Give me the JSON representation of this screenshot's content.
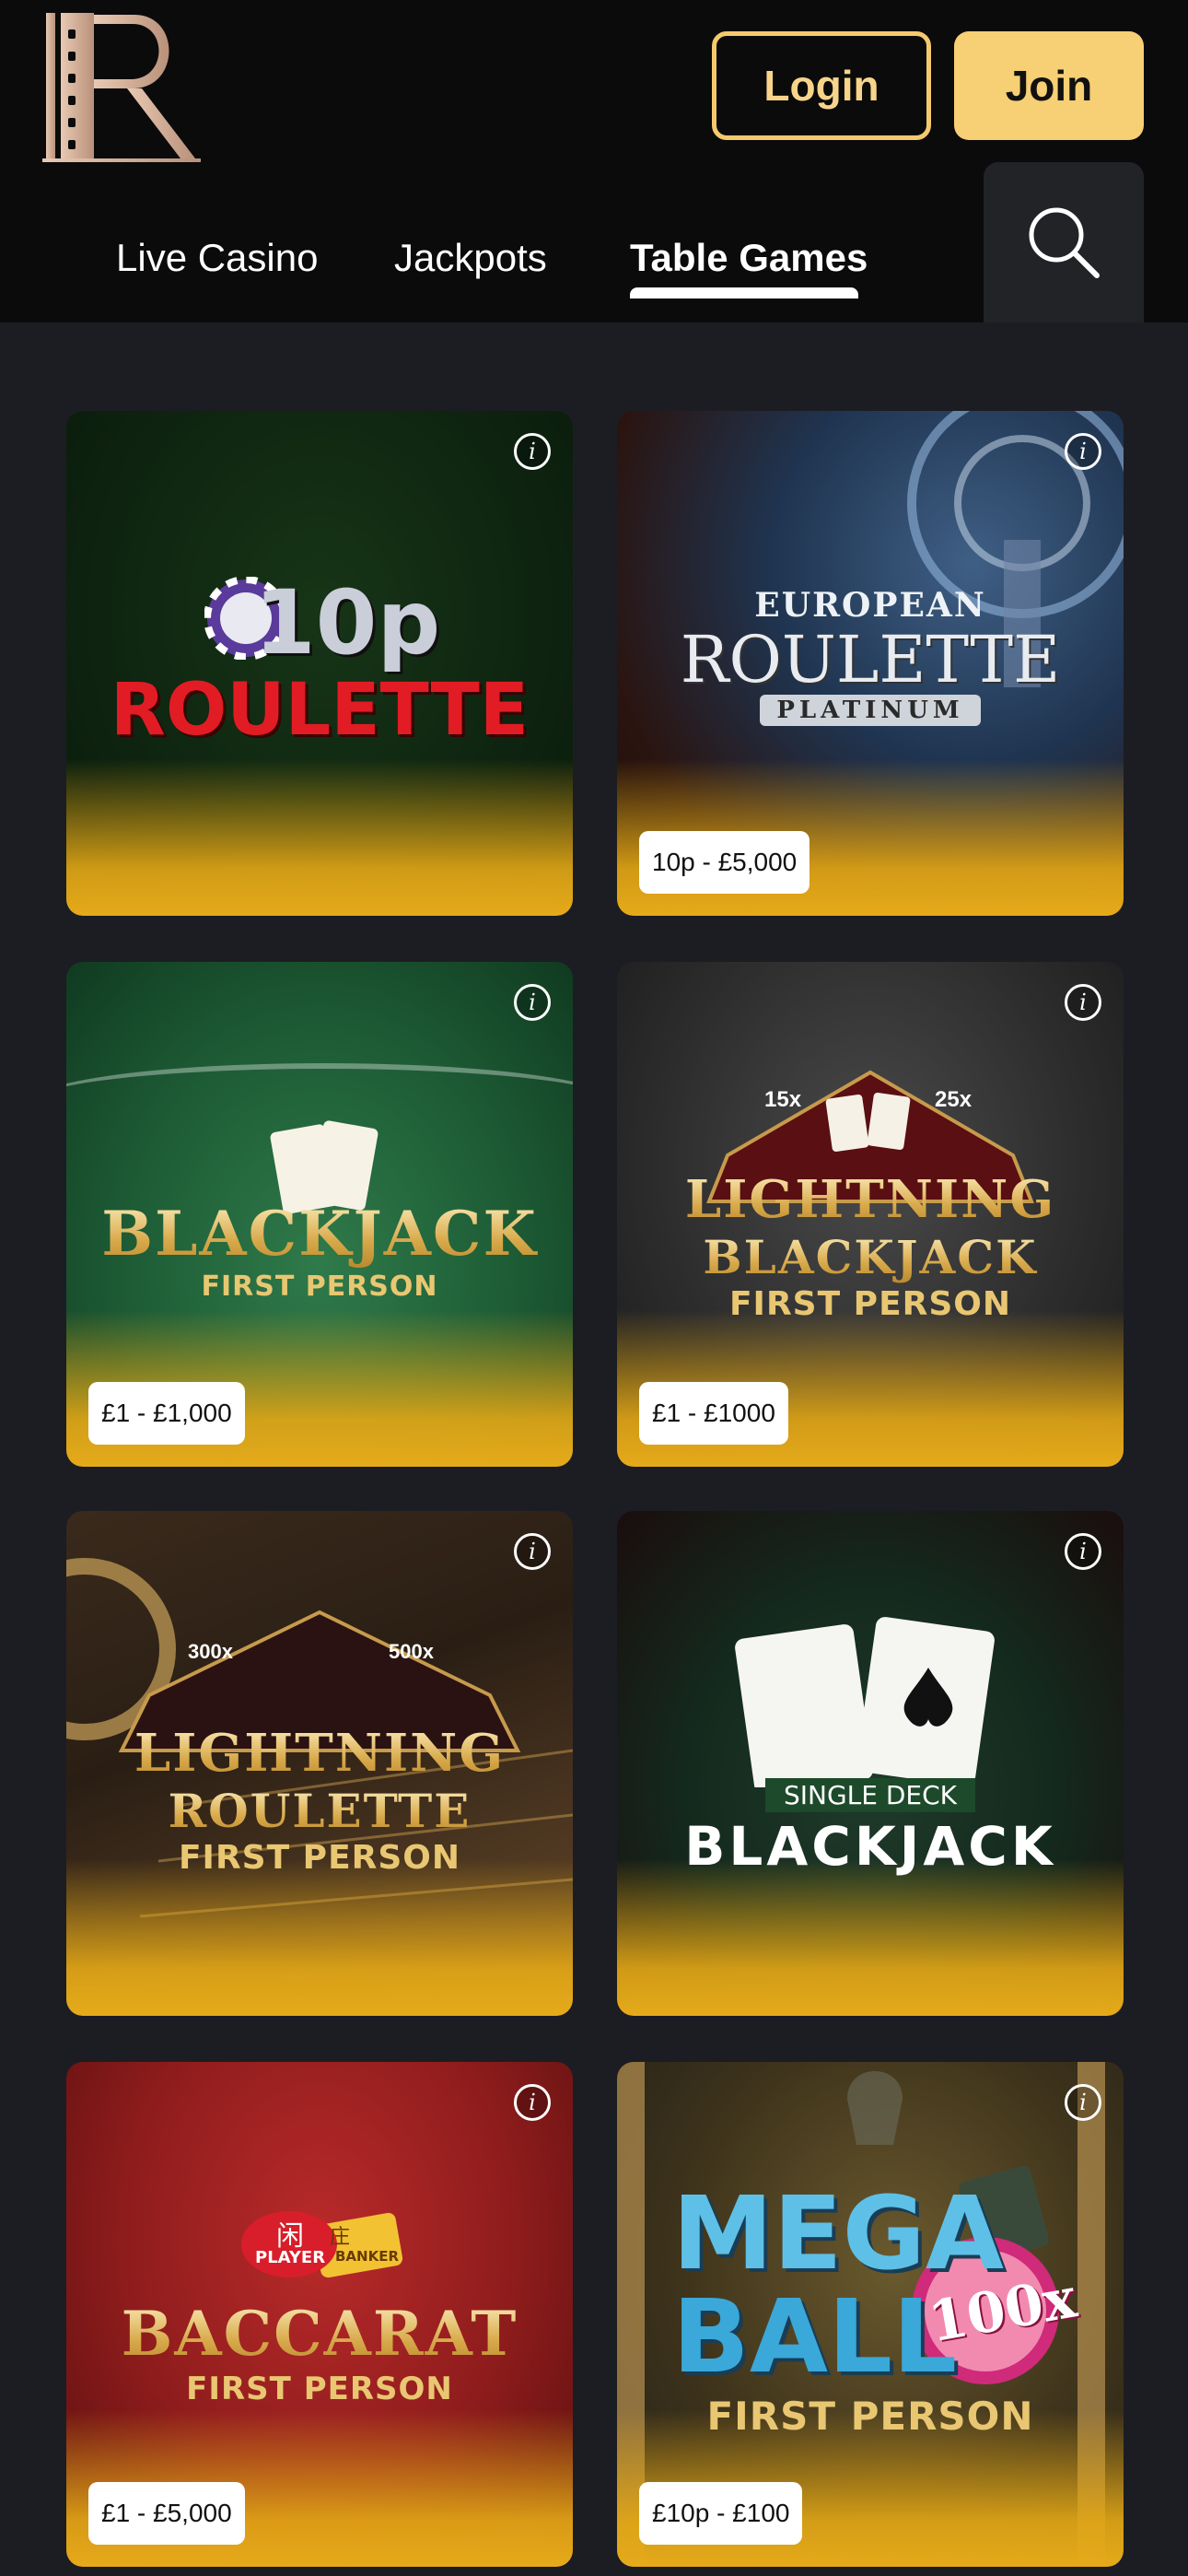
{
  "header": {
    "login_label": "Login",
    "join_label": "Join"
  },
  "nav": {
    "tabs": [
      {
        "label": "Live Casino",
        "active": false
      },
      {
        "label": "Jackpots",
        "active": false
      },
      {
        "label": "Table Games",
        "active": true
      }
    ]
  },
  "games": [
    {
      "title_lines": [
        "10p",
        "ROULETTE"
      ],
      "price": ""
    },
    {
      "title_lines": [
        "EUROPEAN",
        "ROULETTE",
        "PLATINUM"
      ],
      "price": "10p - £5,000"
    },
    {
      "title_lines": [
        "BLACKJACK",
        "FIRST PERSON"
      ],
      "price": "£1 - £1,000"
    },
    {
      "title_lines": [
        "15x",
        "25x",
        "LIGHTNING",
        "BLACKJACK",
        "FIRST PERSON"
      ],
      "price": "£1 - £1000"
    },
    {
      "title_lines": [
        "300x",
        "500x",
        "LIGHTNING",
        "ROULETTE",
        "FIRST PERSON"
      ],
      "price": ""
    },
    {
      "title_lines": [
        "SINGLE DECK",
        "BLACKJACK"
      ],
      "price": ""
    },
    {
      "title_lines": [
        "闲",
        "PLAYER",
        "庄",
        "BANKER",
        "BACCARAT",
        "FIRST PERSON"
      ],
      "price": "£1 - £5,000"
    },
    {
      "title_lines": [
        "MEGA",
        "BALL",
        "100x",
        "FIRST PERSON"
      ],
      "price": "£10p - £100"
    }
  ],
  "icons": {
    "info": "info-icon",
    "search": "search-icon",
    "logo": "logo-r"
  },
  "colors": {
    "accent": "#f7cf74",
    "header_bg": "#0b0b0c",
    "page_bg": "#1c1d22"
  }
}
